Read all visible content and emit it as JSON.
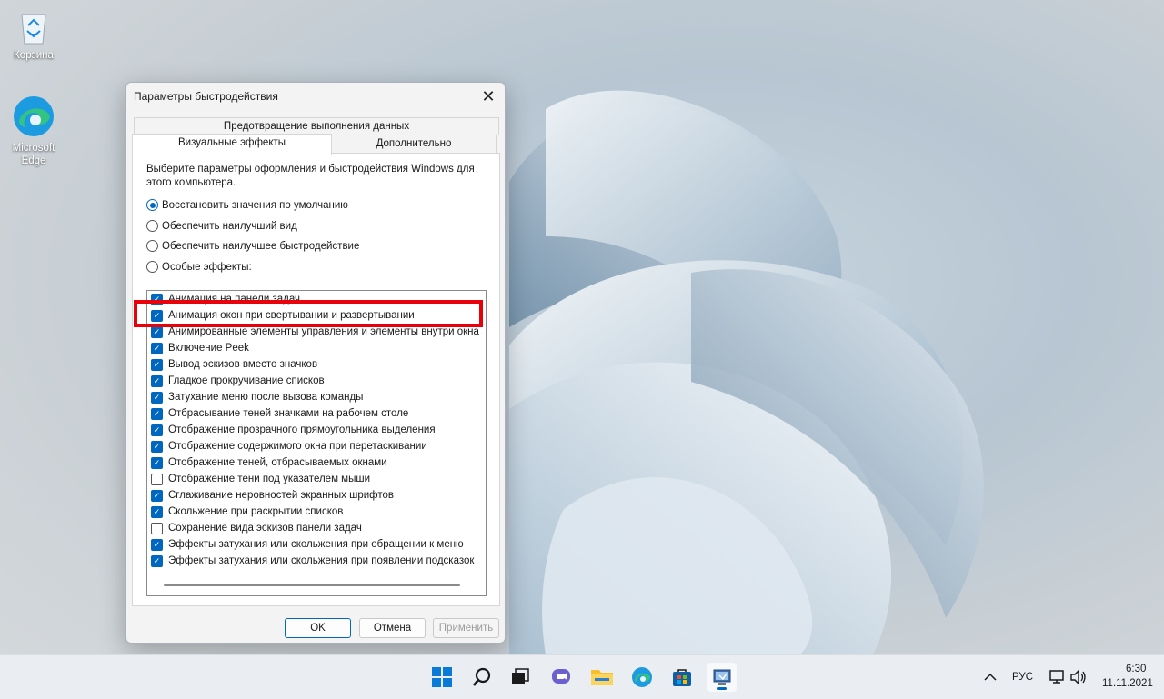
{
  "desktop": {
    "icons": [
      {
        "label": "Корзина",
        "icon": "recycle-bin-icon"
      },
      {
        "label": "Microsoft Edge",
        "icon": "edge-icon"
      }
    ]
  },
  "dialog": {
    "title": "Параметры быстродействия",
    "tabs": {
      "top": "Предотвращение выполнения данных",
      "active": "Визуальные эффекты",
      "inactive": "Дополнительно"
    },
    "description": "Выберите параметры оформления и быстродействия Windows для этого компьютера.",
    "radios": [
      {
        "label": "Восстановить значения по умолчанию",
        "selected": true
      },
      {
        "label": "Обеспечить наилучший вид",
        "selected": false
      },
      {
        "label": "Обеспечить наилучшее быстродействие",
        "selected": false
      },
      {
        "label": "Особые эффекты:",
        "selected": false
      }
    ],
    "effects": [
      {
        "label": "Анимация на панели задач",
        "checked": true
      },
      {
        "label": "Анимация окон при свертывании и развертывании",
        "checked": true
      },
      {
        "label": "Анимированные элементы управления и элементы внутри окна",
        "checked": true
      },
      {
        "label": "Включение Peek",
        "checked": true
      },
      {
        "label": "Вывод эскизов вместо значков",
        "checked": true
      },
      {
        "label": "Гладкое прокручивание списков",
        "checked": true
      },
      {
        "label": "Затухание меню после вызова команды",
        "checked": true
      },
      {
        "label": "Отбрасывание теней значками на рабочем столе",
        "checked": true
      },
      {
        "label": "Отображение прозрачного прямоугольника выделения",
        "checked": true
      },
      {
        "label": "Отображение содержимого окна при перетаскивании",
        "checked": true
      },
      {
        "label": "Отображение теней, отбрасываемых окнами",
        "checked": true
      },
      {
        "label": "Отображение тени под указателем мыши",
        "checked": false
      },
      {
        "label": "Сглаживание неровностей экранных шрифтов",
        "checked": true
      },
      {
        "label": "Скольжение при раскрытии списков",
        "checked": true
      },
      {
        "label": "Сохранение вида эскизов панели задач",
        "checked": false
      },
      {
        "label": "Эффекты затухания или скольжения при обращении к меню",
        "checked": true
      },
      {
        "label": "Эффекты затухания или скольжения при появлении подсказок",
        "checked": true
      }
    ],
    "buttons": {
      "ok": "OK",
      "cancel": "Отмена",
      "apply": "Применить"
    },
    "highlight_color": "#e8000b"
  },
  "taskbar": {
    "icons": [
      "windows-start-icon",
      "search-icon",
      "task-view-icon",
      "chat-icon",
      "file-explorer-icon",
      "edge-icon",
      "store-icon",
      "performance-options-icon"
    ],
    "language": "РУС",
    "time": "6:30",
    "date": "11.11.2021"
  },
  "colors": {
    "accent": "#0067c0"
  }
}
